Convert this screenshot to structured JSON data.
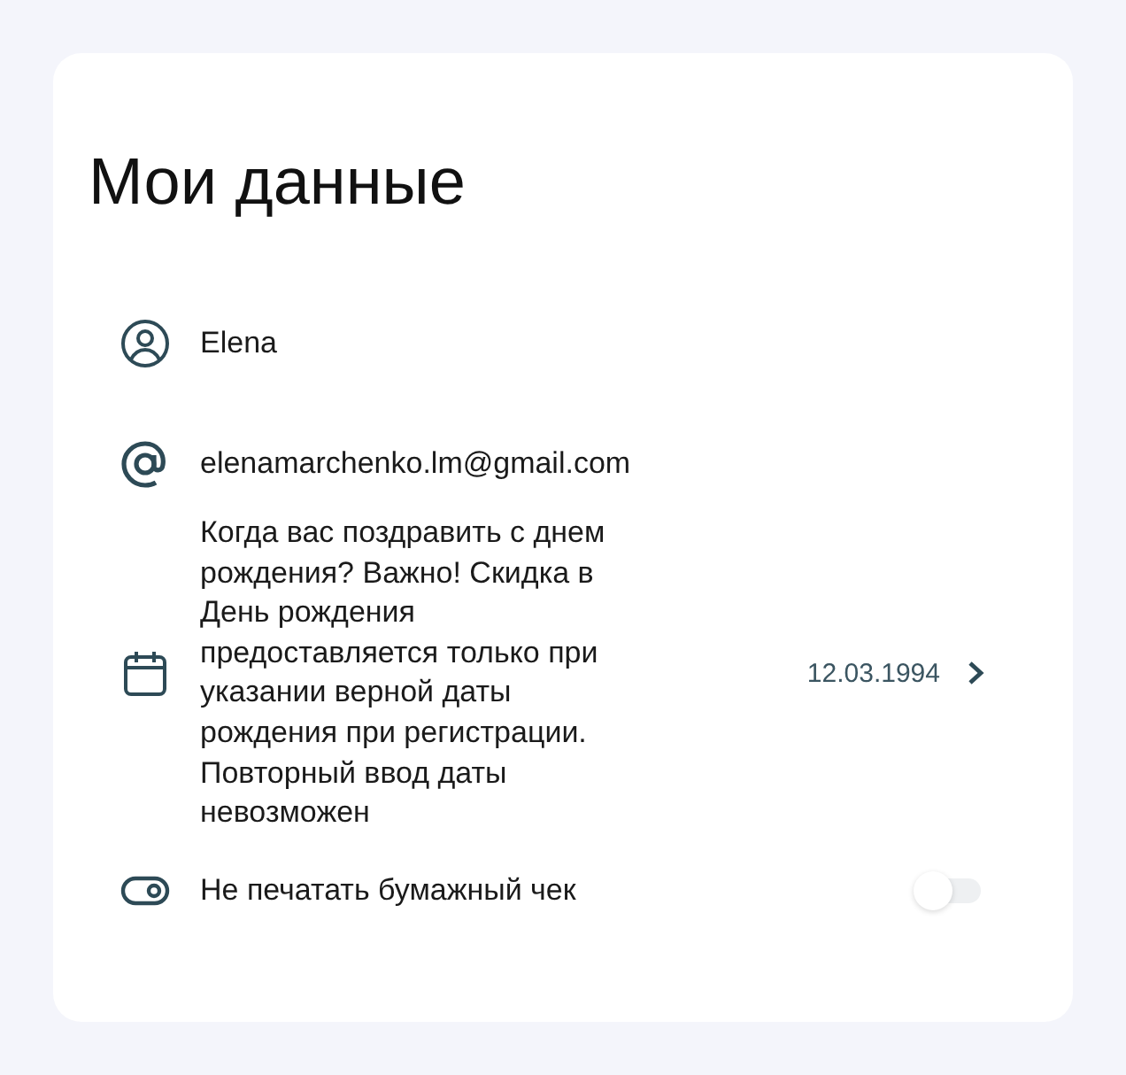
{
  "title": "Мои данные",
  "rows": [
    {
      "kind": "person",
      "label": "Elena"
    },
    {
      "kind": "email",
      "label": "elenamarchenko.lm@gmail.com"
    },
    {
      "kind": "date",
      "label": "Когда вас поздравить с днем рождения? Важно! Скидка в День рождения предоставляется только при указании верной даты рождения при регистрации. Повторный ввод даты невозможен",
      "value": "12.03.1994"
    },
    {
      "kind": "toggle",
      "label": "Не печатать бумажный чек",
      "on": false
    }
  ]
}
